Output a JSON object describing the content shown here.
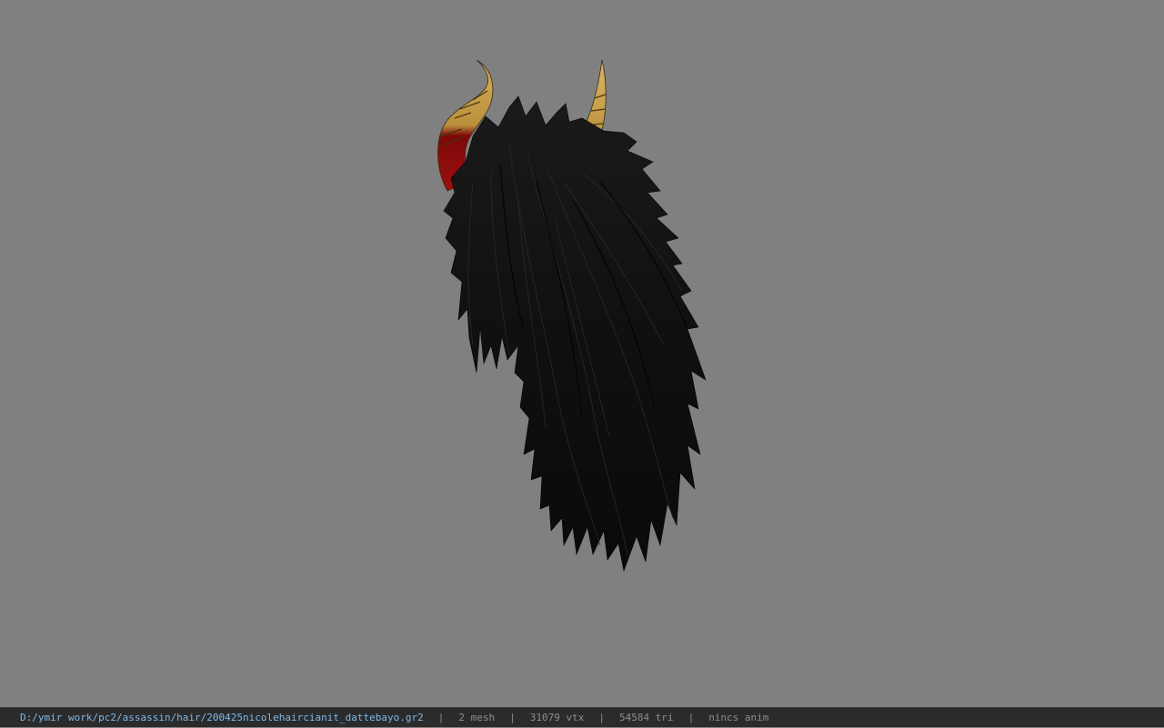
{
  "status_bar": {
    "file_path": "D:/ymir work/pc2/assassin/hair/200425nicolehaircianit_dattebayo.gr2",
    "separator": "|",
    "mesh_count": "2 mesh",
    "vertex_count": "31079 vtx",
    "triangle_count": "54584 tri",
    "anim_status": "nincs anim"
  },
  "colors": {
    "viewport_background": "#808080",
    "status_bar_background": "#2b2b2b",
    "path_text": "#7fb8e8",
    "info_text": "#8e8e8e",
    "hair": "#111111",
    "horn_base": "#8b0a0a",
    "horn_tip": "#c9a24a"
  },
  "viewport": {
    "model": "hair-with-horns-model"
  }
}
